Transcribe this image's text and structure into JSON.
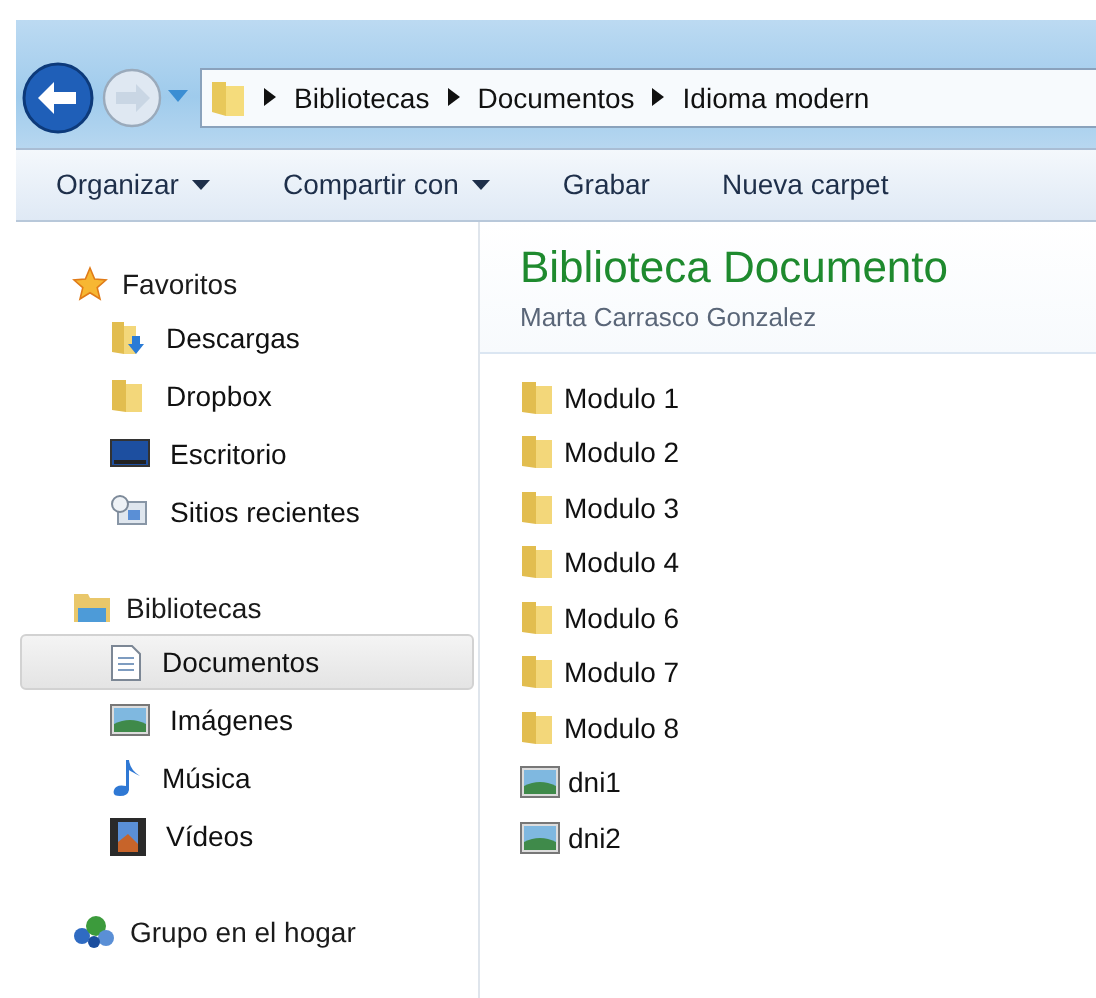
{
  "address_bar": {
    "segments": [
      "Bibliotecas",
      "Documentos",
      "Idioma modern"
    ]
  },
  "toolbar": [
    {
      "label": "Organizar",
      "has_menu": true
    },
    {
      "label": "Compartir con",
      "has_menu": true
    },
    {
      "label": "Grabar",
      "has_menu": false
    },
    {
      "label": "Nueva carpet",
      "has_menu": false
    }
  ],
  "sidebar": {
    "groups": [
      {
        "label": "Favoritos",
        "kind": "star",
        "children": [
          {
            "label": "Descargas",
            "kind": "download",
            "selected": false
          },
          {
            "label": "Dropbox",
            "kind": "folder",
            "selected": false
          },
          {
            "label": "Escritorio",
            "kind": "desktop",
            "selected": false
          },
          {
            "label": "Sitios recientes",
            "kind": "recent",
            "selected": false
          }
        ]
      },
      {
        "label": "Bibliotecas",
        "kind": "library",
        "children": [
          {
            "label": "Documentos",
            "kind": "document",
            "selected": true
          },
          {
            "label": "Imágenes",
            "kind": "image",
            "selected": false
          },
          {
            "label": "Música",
            "kind": "music",
            "selected": false
          },
          {
            "label": "Vídeos",
            "kind": "video",
            "selected": false
          }
        ]
      },
      {
        "label": "Grupo en el hogar",
        "kind": "homegroup"
      }
    ]
  },
  "library": {
    "title": "Biblioteca Documento",
    "subtitle": "Marta Carrasco Gonzalez"
  },
  "files": [
    {
      "name": "Modulo 1",
      "kind": "folder"
    },
    {
      "name": "Modulo 2",
      "kind": "folder"
    },
    {
      "name": "Modulo 3",
      "kind": "folder"
    },
    {
      "name": "Modulo 4",
      "kind": "folder"
    },
    {
      "name": "Modulo 6",
      "kind": "folder"
    },
    {
      "name": "Modulo 7",
      "kind": "folder"
    },
    {
      "name": "Modulo 8",
      "kind": "folder"
    },
    {
      "name": "dni1",
      "kind": "image"
    },
    {
      "name": "dni2",
      "kind": "image"
    }
  ]
}
